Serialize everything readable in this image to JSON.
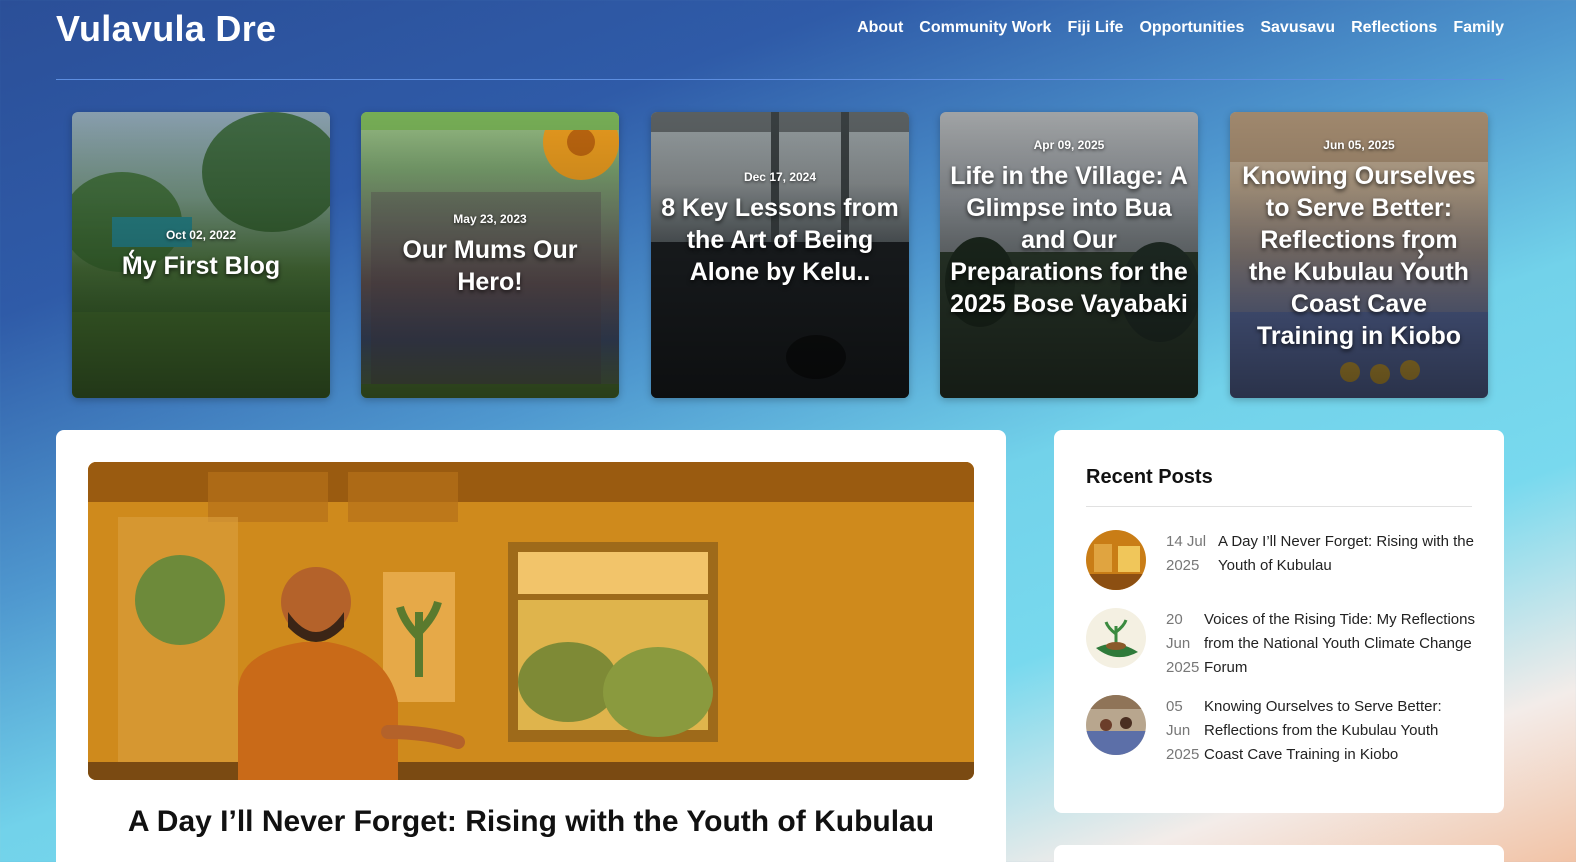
{
  "site": {
    "title": "Vulavula Dre"
  },
  "nav": [
    "About",
    "Community Work",
    "Fiji Life",
    "Opportunities",
    "Savusavu",
    "Reflections",
    "Family"
  ],
  "carousel": {
    "prev_icon": "chevron-left-icon",
    "next_icon": "chevron-right-icon",
    "slides": [
      {
        "date": "Oct 02, 2022",
        "title": "My First Blog"
      },
      {
        "date": "May 23, 2023",
        "title": "Our Mums Our Hero!"
      },
      {
        "date": "Dec 17, 2024",
        "title": "8 Key Lessons from the Art of Being Alone by Kelu.."
      },
      {
        "date": "Apr 09, 2025",
        "title": "Life in the Village: A Glimpse into Bua and Our Preparations for the 2025 Bose Vayabaki"
      },
      {
        "date": "Jun 05, 2025",
        "title": "Knowing Ourselves to Serve Better: Reflections from the Kubulau Youth Coast Cave Training in Kiobo"
      }
    ]
  },
  "featured": {
    "title": "A Day I’ll Never Forget: Rising with the Youth of Kubulau"
  },
  "recent_posts": {
    "heading": "Recent Posts",
    "items": [
      {
        "date": "14 Jul 2025",
        "title": "A Day I’ll Never Forget: Rising with the Youth of Kubulau"
      },
      {
        "date": "20 Jun 2025",
        "title": "Voices of the Rising Tide: My Reflections from the National Youth Climate Change Forum"
      },
      {
        "date": "05 Jun 2025",
        "title": "Knowing Ourselves to Serve Better: Reflections from the Kubulau Youth Coast Cave Training in Kiobo"
      }
    ]
  }
}
